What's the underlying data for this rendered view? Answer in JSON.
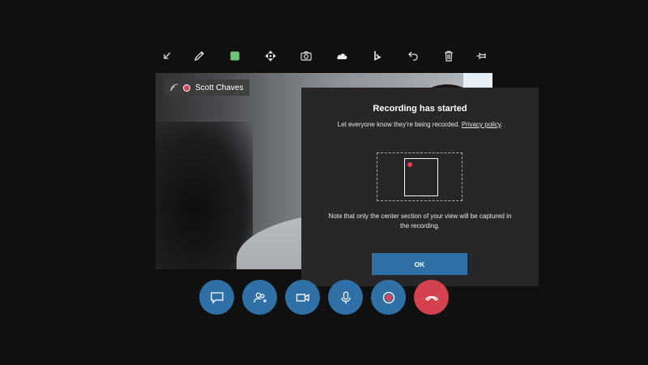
{
  "toolbar": {
    "items": [
      {
        "name": "collapse-icon"
      },
      {
        "name": "pen-icon"
      },
      {
        "name": "color-swatch-icon",
        "color": "#72c27a"
      },
      {
        "name": "move-icon"
      },
      {
        "name": "camera-icon"
      },
      {
        "name": "onedrive-icon"
      },
      {
        "name": "bing-icon"
      },
      {
        "name": "undo-icon"
      },
      {
        "name": "trash-icon"
      },
      {
        "name": "pin-icon"
      }
    ]
  },
  "video": {
    "participant_name": "Scott Chaves"
  },
  "dialog": {
    "title": "Recording has started",
    "subtitle_text": "Let everyone know they're being recorded.",
    "subtitle_link": "Privacy policy",
    "subtitle_end": ".",
    "note": "Note that only the center section of your view will be captured in the recording.",
    "ok_label": "OK"
  },
  "controls": {
    "items": [
      {
        "name": "chat-icon"
      },
      {
        "name": "add-people-icon"
      },
      {
        "name": "video-camera-icon"
      },
      {
        "name": "microphone-icon"
      },
      {
        "name": "record-icon"
      },
      {
        "name": "end-call-icon"
      }
    ],
    "accent_color": "#2f71a6",
    "end_call_color": "#d5424f",
    "record_color": "#e0405a"
  }
}
